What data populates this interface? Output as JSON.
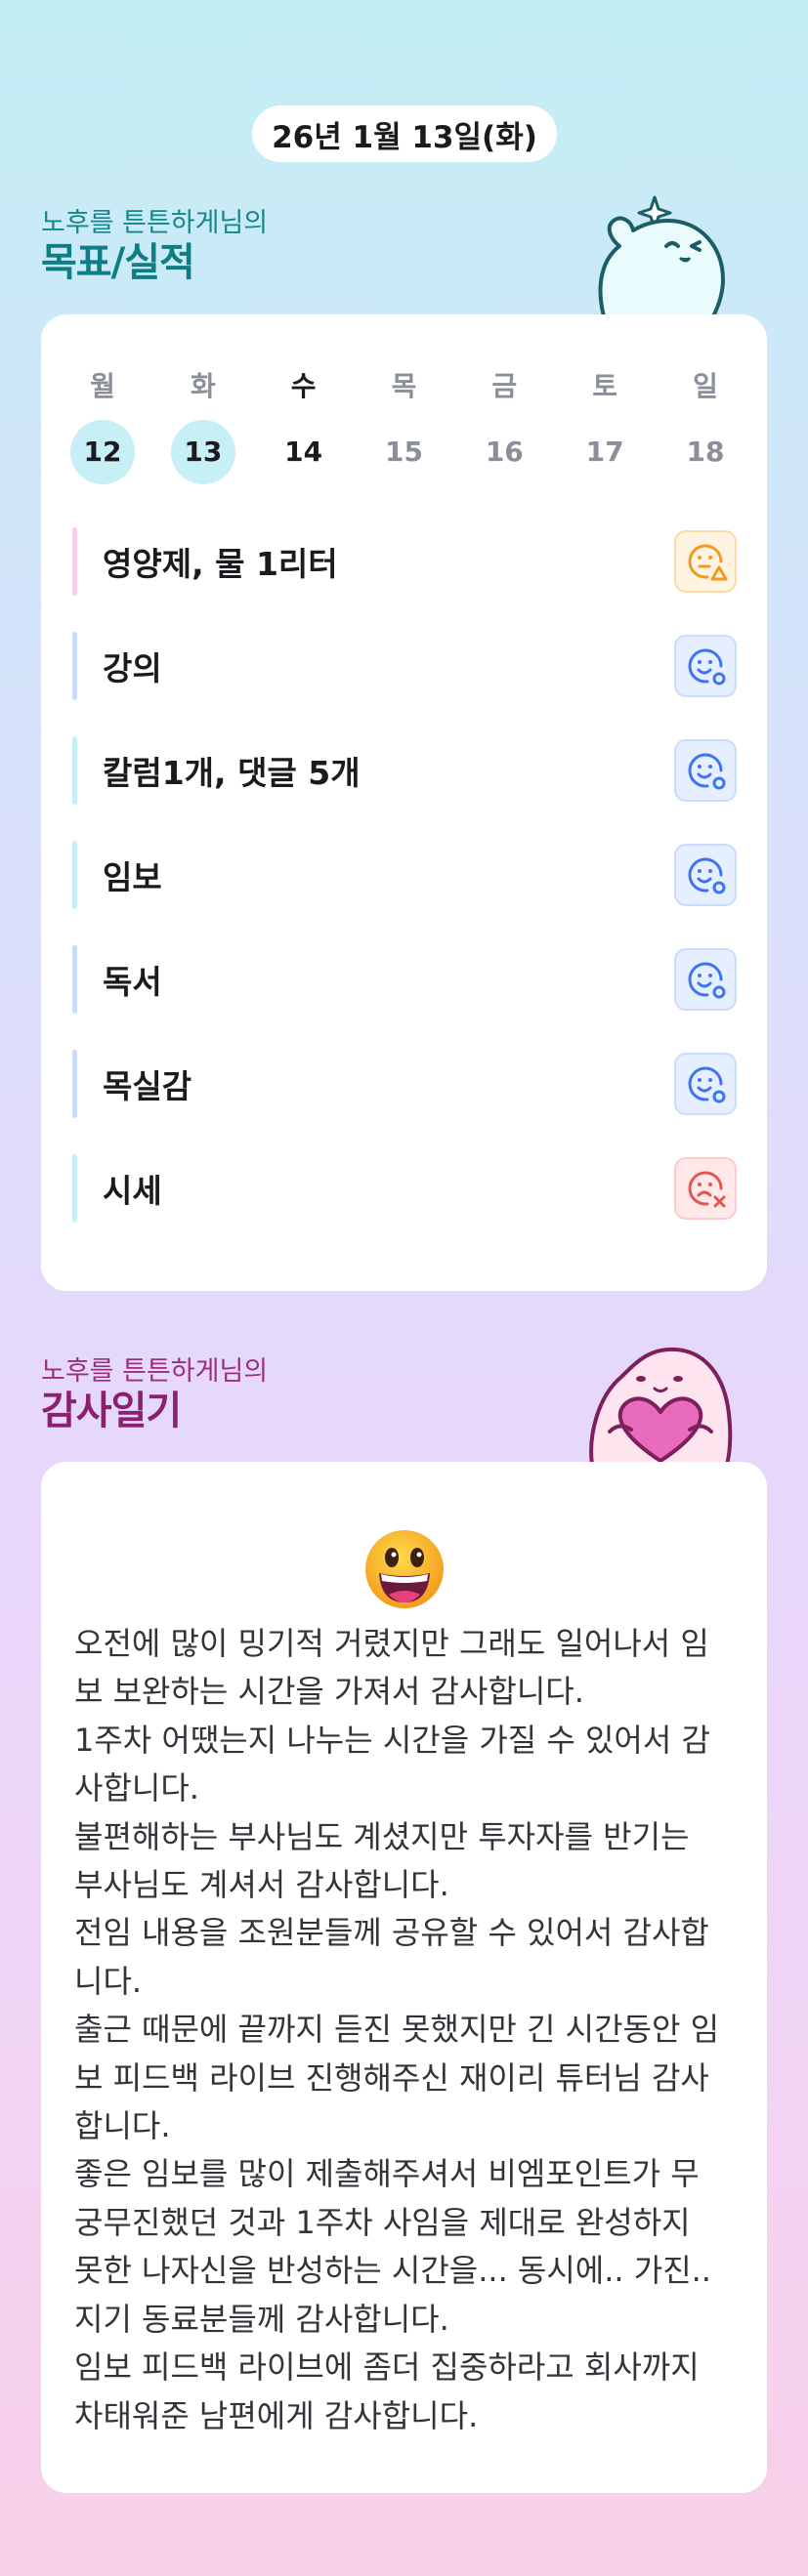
{
  "header": {
    "date": "26년 1월 13일(화)"
  },
  "goals_section": {
    "subtitle": "노후를 튼튼하게님의",
    "title": "목표/실적"
  },
  "week": {
    "days": [
      {
        "label": "월",
        "num": "12",
        "state": "done"
      },
      {
        "label": "화",
        "num": "13",
        "state": "done"
      },
      {
        "label": "수",
        "num": "14",
        "state": "today"
      },
      {
        "label": "목",
        "num": "15",
        "state": "future"
      },
      {
        "label": "금",
        "num": "16",
        "state": "future"
      },
      {
        "label": "토",
        "num": "17",
        "state": "future"
      },
      {
        "label": "일",
        "num": "18",
        "state": "future"
      }
    ]
  },
  "goals": [
    {
      "label": "영양제, 물 1리터",
      "status": "partial",
      "bar_color": "#f8cde6"
    },
    {
      "label": "강의",
      "status": "success",
      "bar_color": "#c9dbff"
    },
    {
      "label": "칼럼1개, 댓글 5개",
      "status": "success",
      "bar_color": "#c6eff6"
    },
    {
      "label": "임보",
      "status": "success",
      "bar_color": "#c6eff6"
    },
    {
      "label": "독서",
      "status": "success",
      "bar_color": "#c9dbff"
    },
    {
      "label": "목실감",
      "status": "success",
      "bar_color": "#c9dbff"
    },
    {
      "label": "시세",
      "status": "fail",
      "bar_color": "#c6eff6"
    }
  ],
  "status_icons": {
    "success": "smile-o-icon",
    "partial": "smile-triangle-icon",
    "fail": "sad-x-icon"
  },
  "diary_section": {
    "subtitle": "노후를 튼튼하게님의",
    "title": "감사일기"
  },
  "diary": {
    "emoji": "grinning-face-emoji",
    "lines": [
      "오전에 많이 밍기적 거렸지만 그래도 일어나서 임",
      "보 보완하는 시간을 가져서 감사합니다.",
      "1주차 어땠는지 나누는 시간을 가질 수 있어서 감",
      "사합니다.",
      "불편해하는 부사님도 계셨지만 투자자를 반기는",
      "부사님도 계셔서 감사합니다.",
      "전임 내용을 조원분들께 공유할 수 있어서 감사합",
      "니다.",
      "출근 때문에 끝까지 듣진 못했지만 긴 시간동안 임",
      "보 피드백 라이브 진행해주신 재이리 튜터님 감사",
      "합니다.",
      "좋은 임보를 많이 제출해주셔서 비엠포인트가 무",
      "궁무진했던 것과 1주차 사임을 제대로 완성하지",
      "못한 나자신을 반성하는 시간을... 동시에.. 가진..",
      "지기 동료분들께 감사합니다.",
      "임보 피드백 라이브에 좀더 집중하라고 회사까지",
      "차태워준 남편에게 감사합니다."
    ]
  },
  "colors": {
    "accent_teal": "#16868a",
    "accent_plum": "#9c2e7d",
    "success_blue": "#3e74f0",
    "partial_orange": "#f29a1e",
    "fail_red": "#e2574f"
  }
}
